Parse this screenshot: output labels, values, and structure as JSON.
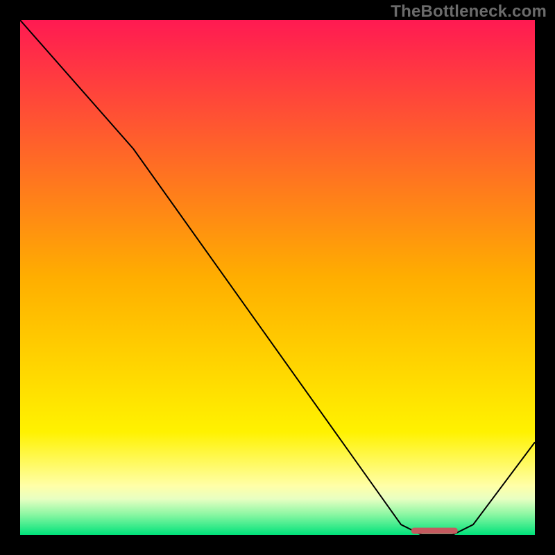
{
  "watermark": "TheBottleneck.com",
  "chart_data": {
    "type": "line",
    "title": "",
    "xlabel": "",
    "ylabel": "",
    "xlim": [
      0,
      100
    ],
    "ylim": [
      0,
      100
    ],
    "grid": false,
    "curve": [
      {
        "x": 0,
        "y": 100
      },
      {
        "x": 22,
        "y": 75
      },
      {
        "x": 74,
        "y": 2
      },
      {
        "x": 78,
        "y": 0
      },
      {
        "x": 84,
        "y": 0
      },
      {
        "x": 88,
        "y": 2
      },
      {
        "x": 100,
        "y": 18
      }
    ],
    "marker": {
      "x_start": 76,
      "x_end": 85,
      "y": 0.8
    },
    "colors": {
      "gradient_stops": [
        {
          "offset": 0.0,
          "color": "#ff1a52"
        },
        {
          "offset": 0.5,
          "color": "#ffae00"
        },
        {
          "offset": 0.8,
          "color": "#fff200"
        },
        {
          "offset": 0.905,
          "color": "#ffffa8"
        },
        {
          "offset": 0.93,
          "color": "#e8ffc2"
        },
        {
          "offset": 0.96,
          "color": "#8cf7a3"
        },
        {
          "offset": 1.0,
          "color": "#00e27a"
        }
      ],
      "curve_stroke": "#000000",
      "marker_fill": "#c45a5f"
    }
  }
}
